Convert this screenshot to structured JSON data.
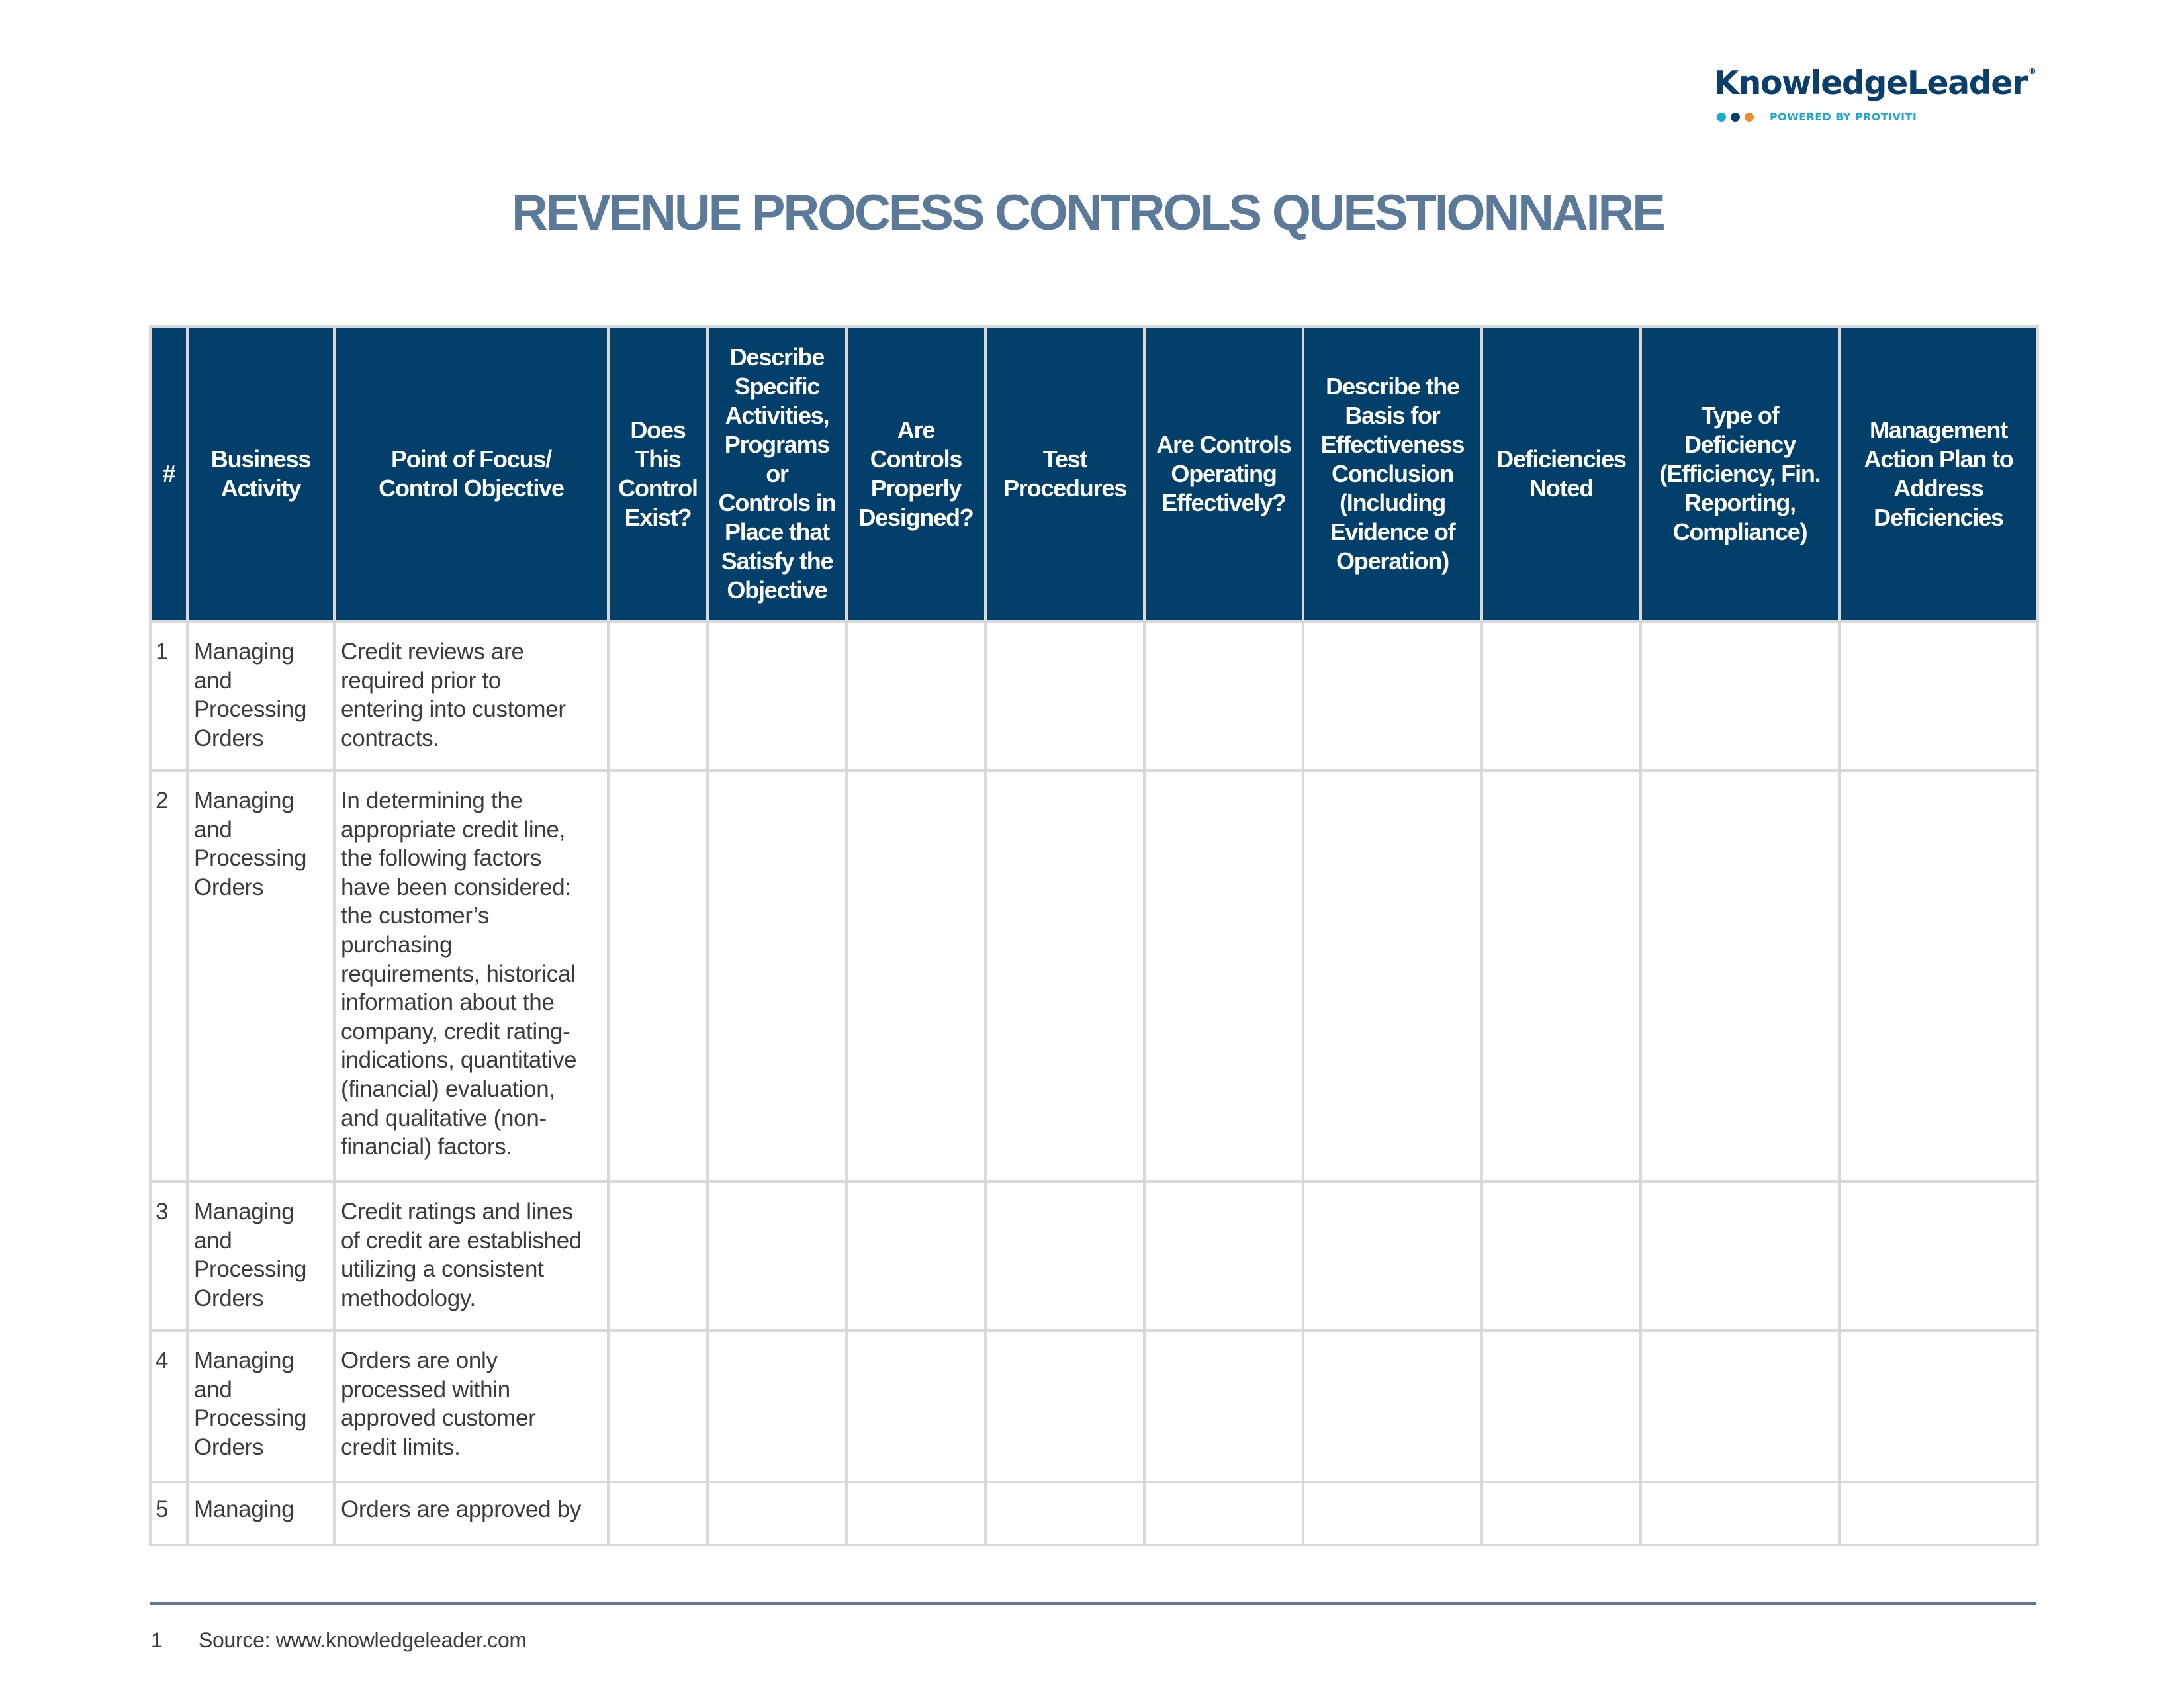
{
  "colors": {
    "brand_navy": "#0b3f6b",
    "header_bg": "#023f6a",
    "title": "#5b7a9a",
    "tagline": "#1aa9cc",
    "dot_teal": "#12aed0",
    "dot_navy": "#0b3f6b",
    "dot_orange": "#f28b26",
    "grid": "#d9d9d9",
    "body_text": "#3b3b3b"
  },
  "logo": {
    "wordmark": "KnowledgeLeader",
    "registered_mark": "®",
    "tagline": "POWERED BY PROTIVITI",
    "dots": [
      "teal",
      "navy",
      "orange"
    ]
  },
  "title": "REVENUE PROCESS CONTROLS QUESTIONNAIRE",
  "table": {
    "columns": [
      "#",
      "Business\nActivity",
      "Point of Focus/\nControl Objective",
      "Does\nThis\nControl\nExist?",
      "Describe\nSpecific\nActivities,\nPrograms\nor\nControls in\nPlace that\nSatisfy the\nObjective",
      "Are\nControls\nProperly\nDesigned?",
      "Test\nProcedures",
      "Are Controls\nOperating\nEffectively?",
      "Describe the\nBasis for\nEffectiveness\nConclusion\n(Including\nEvidence of\nOperation)",
      "Deficiencies\nNoted",
      "Type of\nDeficiency\n(Efficiency, Fin.\nReporting,\nCompliance)",
      "Management\nAction Plan to\nAddress\nDeficiencies"
    ],
    "rows": [
      {
        "num": "1",
        "activity": "Managing\nand\nProcessing\nOrders",
        "objective": "Credit reviews are\nrequired prior to\nentering into customer\ncontracts.",
        "control_exists": "",
        "describe_activities": "",
        "properly_designed": "",
        "test_procedures": "",
        "operating_effectively": "",
        "basis_for_conclusion": "",
        "deficiencies_noted": "",
        "deficiency_type": "",
        "action_plan": ""
      },
      {
        "num": "2",
        "activity": "Managing\nand\nProcessing\nOrders",
        "objective": "In determining the\nappropriate credit line,\nthe following factors\nhave been considered:\nthe customer’s\npurchasing\nrequirements, historical\ninformation about the\ncompany, credit rating-\nindications, quantitative\n(financial) evaluation,\nand qualitative (non-\nfinancial) factors.",
        "control_exists": "",
        "describe_activities": "",
        "properly_designed": "",
        "test_procedures": "",
        "operating_effectively": "",
        "basis_for_conclusion": "",
        "deficiencies_noted": "",
        "deficiency_type": "",
        "action_plan": ""
      },
      {
        "num": "3",
        "activity": "Managing\nand\nProcessing\nOrders",
        "objective": "Credit ratings and lines\nof credit are established\nutilizing a consistent\nmethodology.",
        "control_exists": "",
        "describe_activities": "",
        "properly_designed": "",
        "test_procedures": "",
        "operating_effectively": "",
        "basis_for_conclusion": "",
        "deficiencies_noted": "",
        "deficiency_type": "",
        "action_plan": ""
      },
      {
        "num": "4",
        "activity": "Managing\nand\nProcessing\nOrders",
        "objective": "Orders are only\nprocessed within\napproved customer\ncredit limits.",
        "control_exists": "",
        "describe_activities": "",
        "properly_designed": "",
        "test_procedures": "",
        "operating_effectively": "",
        "basis_for_conclusion": "",
        "deficiencies_noted": "",
        "deficiency_type": "",
        "action_plan": ""
      },
      {
        "num": "5",
        "activity": "Managing",
        "objective": "Orders are approved by",
        "control_exists": "",
        "describe_activities": "",
        "properly_designed": "",
        "test_procedures": "",
        "operating_effectively": "",
        "basis_for_conclusion": "",
        "deficiencies_noted": "",
        "deficiency_type": "",
        "action_plan": ""
      }
    ]
  },
  "footer": {
    "page_number": "1",
    "source": "Source: www.knowledgeleader.com"
  }
}
